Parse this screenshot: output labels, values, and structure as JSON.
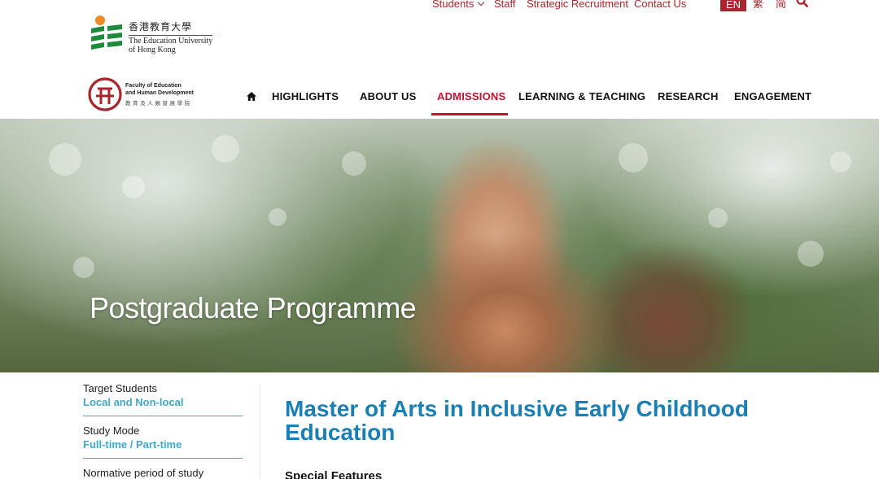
{
  "utility_nav": {
    "students": "Students",
    "staff": "Staff",
    "strategic": "Strategic Recruitment",
    "contact": "Contact Us",
    "lang_en": "EN",
    "lang_tc": "繁",
    "lang_sc": "简"
  },
  "university": {
    "name_zh": "香港教育大學",
    "name_en_1": "The Education University",
    "name_en_2": "of Hong Kong"
  },
  "faculty": {
    "name_en_1": "Faculty of Education",
    "name_en_2": "and Human Development",
    "name_zh": "教育及人類發展學院"
  },
  "main_nav": {
    "highlights": "HIGHLIGHTS",
    "about": "ABOUT US",
    "admissions": "ADMISSIONS",
    "learning": "LEARNING & TEACHING",
    "research": "RESEARCH",
    "engagement": "ENGAGEMENT"
  },
  "hero": {
    "title": "Postgraduate Programme"
  },
  "sidebar": {
    "items": [
      {
        "label": "Target Students",
        "value": "Local and Non-local"
      },
      {
        "label": "Study Mode",
        "value": "Full-time / Part-time"
      },
      {
        "label": "Normative period of study",
        "value": ""
      }
    ]
  },
  "main": {
    "title": "Master of Arts in Inclusive Early Childhood Education",
    "section_heading": "Special Features"
  },
  "colors": {
    "brand_red": "#a8262c",
    "active_red": "#c8102e",
    "accent_blue": "#1a7fb4",
    "link_cyan": "#3fa8c9"
  }
}
